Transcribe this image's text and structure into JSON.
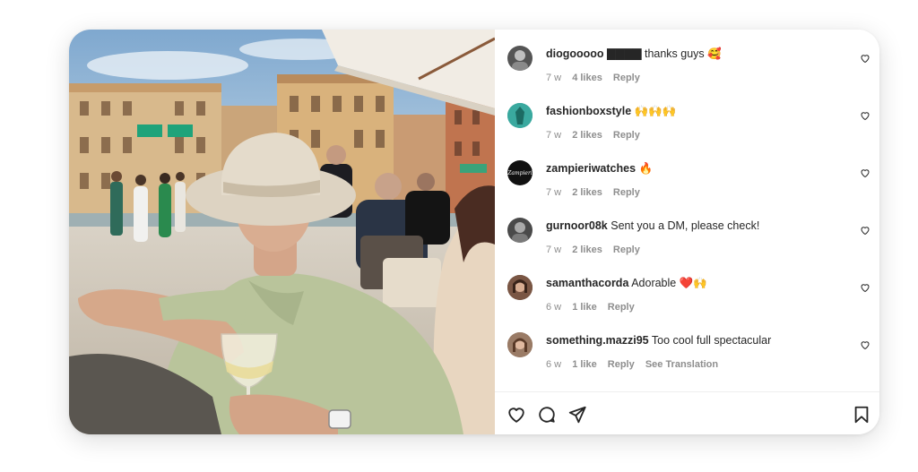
{
  "post": {
    "image_alt": "Man in a wide-brim hat holding a glass of white wine at a canal-side cafe"
  },
  "comments": [
    {
      "username": "diogooooo",
      "text": "▇▇▇▇ thanks guys 🥰",
      "age": "7 w",
      "likes": "4 likes",
      "reply": "Reply",
      "avatar_color": "#555555"
    },
    {
      "username": "fashionboxstyle",
      "text": "🙌🙌🙌",
      "age": "7 w",
      "likes": "2 likes",
      "reply": "Reply",
      "avatar_color": "#3aa99f"
    },
    {
      "username": "zampieriwatches",
      "text": "🔥",
      "age": "7 w",
      "likes": "2 likes",
      "reply": "Reply",
      "avatar_color": "#111111",
      "avatar_text": "Zampieri"
    },
    {
      "username": "gurnoor08k",
      "text": "Sent you a DM, please check!",
      "age": "7 w",
      "likes": "2 likes",
      "reply": "Reply",
      "avatar_color": "#4a4a4a"
    },
    {
      "username": "samanthacorda",
      "text": "Adorable ❤️🙌",
      "age": "6 w",
      "likes": "1 like",
      "reply": "Reply",
      "avatar_color": "#6b4a3a"
    },
    {
      "username": "something.mazzi95",
      "text": "Too cool full spectacular",
      "age": "6 w",
      "likes": "1 like",
      "reply": "Reply",
      "see_translation": "See Translation",
      "avatar_color": "#8a6d5a"
    }
  ],
  "icons": {
    "like": "heart-icon",
    "comment": "comment-icon",
    "share": "paper-plane-icon",
    "save": "bookmark-icon",
    "comment_like": "small-heart-icon"
  }
}
